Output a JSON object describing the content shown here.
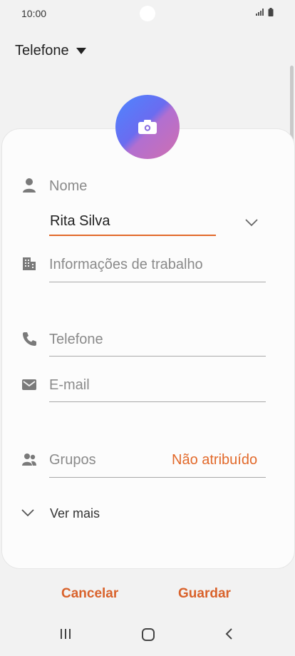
{
  "status_bar": {
    "time": "10:00"
  },
  "account": {
    "label": "Telefone"
  },
  "form": {
    "name_label": "Nome",
    "name_value": "Rita Silva",
    "work_label": "Informações de trabalho",
    "phone_placeholder": "Telefone",
    "email_placeholder": "E-mail",
    "groups_label": "Grupos",
    "groups_value": "Não atribuído",
    "more_label": "Ver mais"
  },
  "actions": {
    "cancel": "Cancelar",
    "save": "Guardar"
  },
  "colors": {
    "accent": "#e2692a",
    "button": "#d9622b",
    "background": "#f2f2f2",
    "card": "#fcfcfc"
  }
}
